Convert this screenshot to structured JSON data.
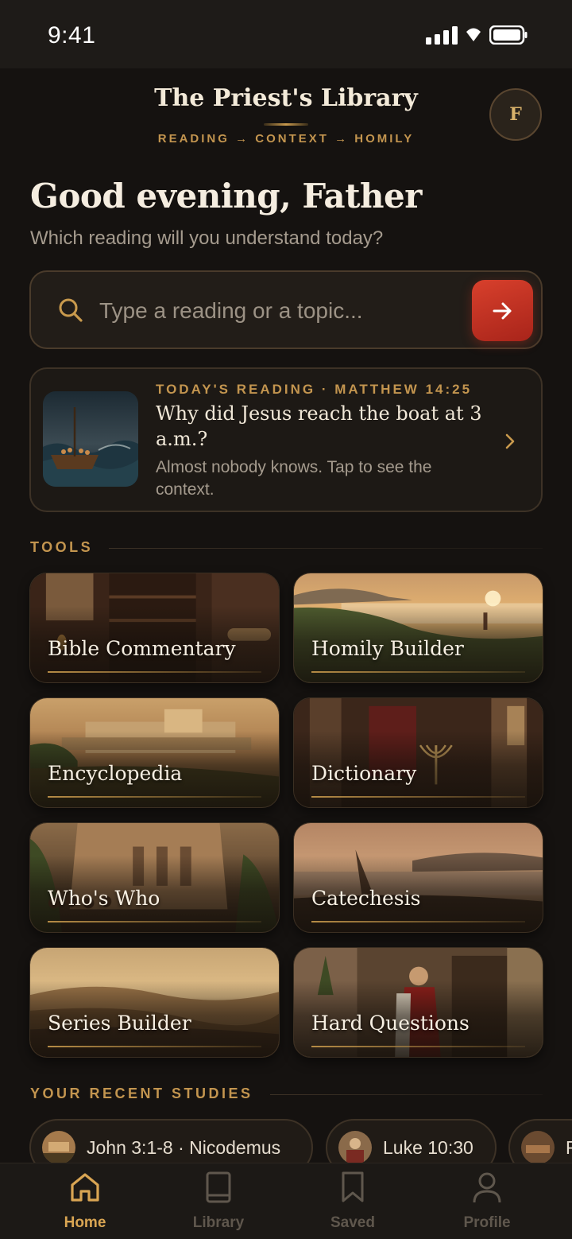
{
  "status_bar": {
    "time": "9:41"
  },
  "header": {
    "title": "The Priest's Library",
    "tagline": "READING → CONTEXT → HOMILY",
    "avatar_initial": "F"
  },
  "greeting": {
    "title": "Good evening, Father",
    "subtitle": "Which reading will you understand today?"
  },
  "search": {
    "placeholder": "Type a reading or a topic...",
    "icon": "search-icon",
    "submit_icon": "arrow-right-icon"
  },
  "today": {
    "kicker": "TODAY'S READING · MATTHEW 14:25",
    "title": "Why did Jesus reach the boat at 3 a.m.?",
    "description": "Almost nobody knows. Tap to see the context."
  },
  "tools": {
    "heading": "TOOLS",
    "items": [
      {
        "label": "Bible Commentary"
      },
      {
        "label": "Homily Builder"
      },
      {
        "label": "Encyclopedia"
      },
      {
        "label": "Dictionary"
      },
      {
        "label": "Who's Who"
      },
      {
        "label": "Catechesis"
      },
      {
        "label": "Series Builder"
      },
      {
        "label": "Hard Questions"
      }
    ]
  },
  "recent": {
    "heading": "YOUR RECENT STUDIES",
    "items": [
      {
        "label": "John 3:1-8 · Nicodemus"
      },
      {
        "label": "Luke 10:30"
      },
      {
        "label": "R"
      }
    ]
  },
  "nav": {
    "items": [
      {
        "label": "Home",
        "icon": "home-icon",
        "active": true
      },
      {
        "label": "Library",
        "icon": "book-icon",
        "active": false
      },
      {
        "label": "Saved",
        "icon": "bookmark-icon",
        "active": false
      },
      {
        "label": "Profile",
        "icon": "profile-icon",
        "active": false
      }
    ]
  },
  "colors": {
    "background": "#151210",
    "accent_gold": "#c3954f",
    "accent_red": "#c9342a",
    "nav_active": "#d9a553",
    "nav_inactive": "#5f574d"
  }
}
